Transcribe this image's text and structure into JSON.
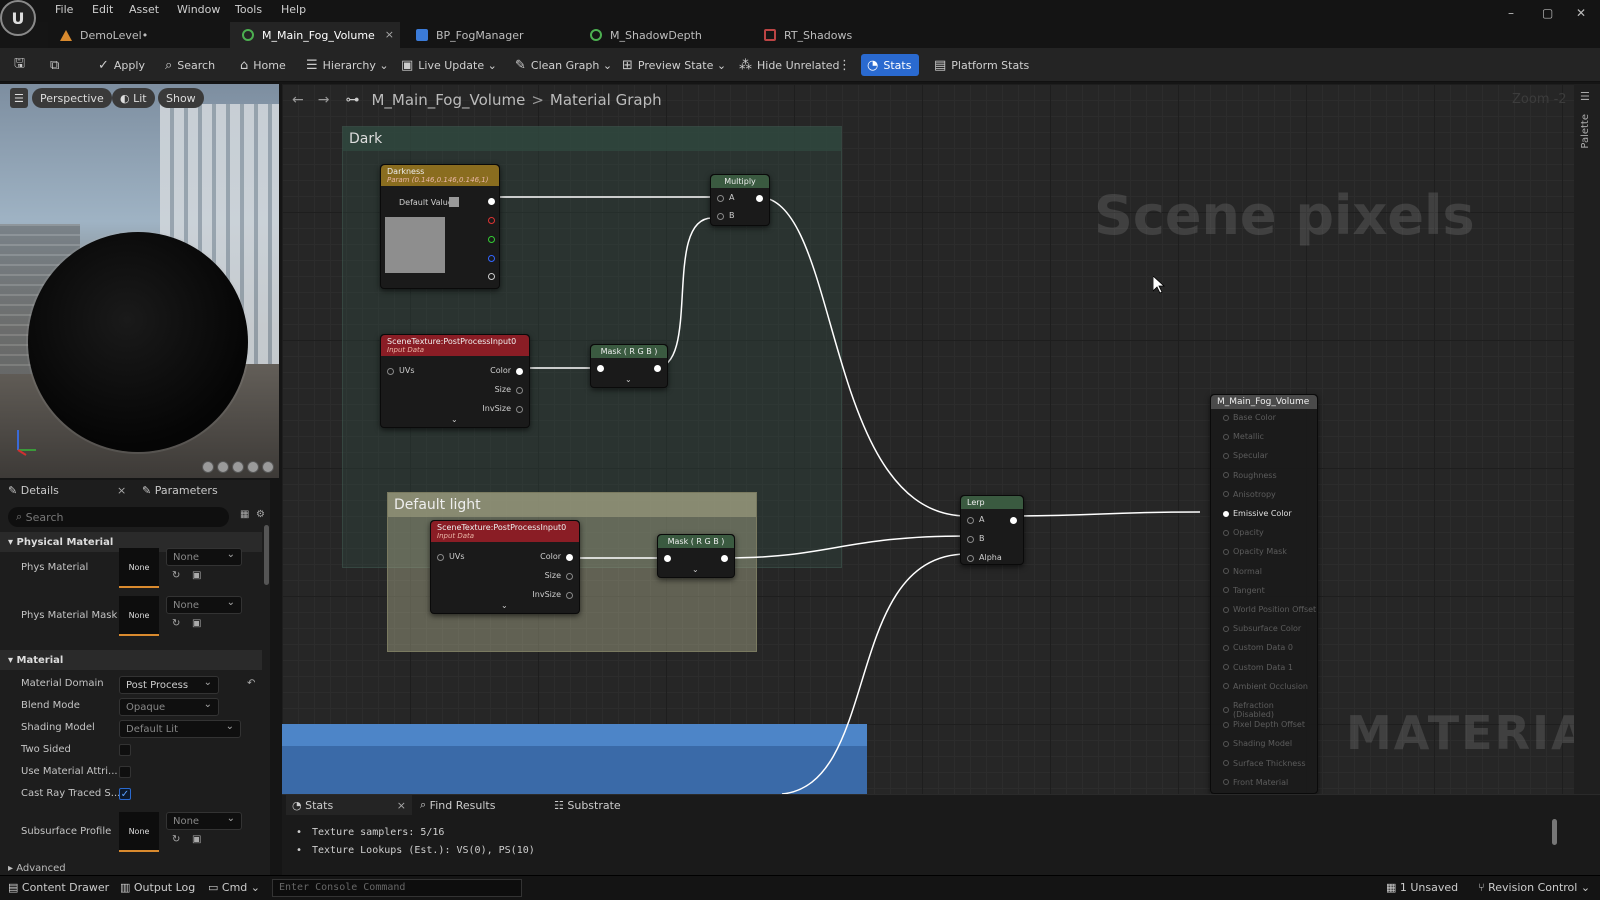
{
  "app": {
    "logo": "U"
  },
  "menu": [
    "File",
    "Edit",
    "Asset",
    "Window",
    "Tools",
    "Help"
  ],
  "tabs": [
    {
      "label": "DemoLevel•"
    },
    {
      "label": "M_Main_Fog_Volume",
      "active": true,
      "close": "×"
    },
    {
      "label": "BP_FogManager"
    },
    {
      "label": "M_ShadowDepth"
    },
    {
      "label": "RT_Shadows"
    }
  ],
  "window_controls": [
    "–",
    "▢",
    "✕"
  ],
  "toolbar": {
    "apply": "Apply",
    "search": "Search",
    "home": "Home",
    "hierarchy": "Hierarchy",
    "live_update": "Live Update",
    "clean_graph": "Clean Graph",
    "preview_state": "Preview State",
    "hide_unrelated": "Hide Unrelated",
    "stats": "Stats",
    "platform_stats": "Platform Stats"
  },
  "viewport": {
    "perspective": "Perspective",
    "lit": "Lit",
    "show": "Show"
  },
  "details": {
    "tab_details": "Details",
    "tab_parameters": "Parameters",
    "search_placeholder": "Search",
    "cat_physical": "Physical Material",
    "cat_material": "Material",
    "cat_advanced": "Advanced",
    "phys_material": "Phys Material",
    "phys_material_mask": "Phys Material Mask",
    "none": "None",
    "material_domain": "Material Domain",
    "material_domain_value": "Post Process",
    "blend_mode": "Blend Mode",
    "blend_mode_value": "Opaque",
    "shading_model": "Shading Model",
    "shading_model_value": "Default Lit",
    "two_sided": "Two Sided",
    "use_material_attr": "Use Material Attri...",
    "cast_ray": "Cast Ray Traced S...",
    "subsurface_profile": "Subsurface Profile"
  },
  "graph": {
    "breadcrumb_asset": "M_Main_Fog_Volume",
    "breadcrumb_sep": ">",
    "breadcrumb_view": "Material Graph",
    "zoom": "Zoom -2",
    "palette": "Palette",
    "watermark_scene": "Scene pixels",
    "watermark_material": "MATERIAL",
    "comment_dark": "Dark",
    "comment_light": "Default light",
    "darkness_title": "Darkness",
    "darkness_sub": "Param (0.146,0.146,0.146,1)",
    "default_value": "Default Value",
    "multiply": "Multiply",
    "pin_a": "A",
    "pin_b": "B",
    "pin_alpha": "Alpha",
    "scenetex": "SceneTexture:PostProcessInput0",
    "input_data": "Input Data",
    "uvs": "UVs",
    "color": "Color",
    "size": "Size",
    "invsize": "InvSize",
    "mask": "Mask ( R G B )",
    "lerp": "Lerp",
    "result_title": "M_Main_Fog_Volume",
    "result_pins": [
      "Base Color",
      "Metallic",
      "Specular",
      "Roughness",
      "Anisotropy",
      "Emissive Color",
      "Opacity",
      "Opacity Mask",
      "Normal",
      "Tangent",
      "World Position Offset",
      "Subsurface Color",
      "Custom Data 0",
      "Custom Data 1",
      "Ambient Occlusion",
      "Refraction (Disabled)",
      "Pixel Depth Offset",
      "Shading Model",
      "Surface Thickness",
      "Front Material"
    ]
  },
  "stats": {
    "tab_stats": "Stats",
    "tab_find": "Find Results",
    "tab_substrate": "Substrate",
    "line1": "Texture samplers: 5/16",
    "line2": "Texture Lookups (Est.): VS(0), PS(10)"
  },
  "bottombar": {
    "content_drawer": "Content Drawer",
    "output_log": "Output Log",
    "cmd": "Cmd",
    "console_placeholder": "Enter Console Command",
    "unsaved": "1 Unsaved",
    "revision": "Revision Control"
  },
  "colors": {
    "accent": "#2a6ad0",
    "param_header": "#8a6d1f",
    "scenetex_header": "#8a1d25",
    "mask_header": "#3a5a40",
    "lerp_header": "#3a5a40",
    "result_header": "#4a4a4a"
  }
}
